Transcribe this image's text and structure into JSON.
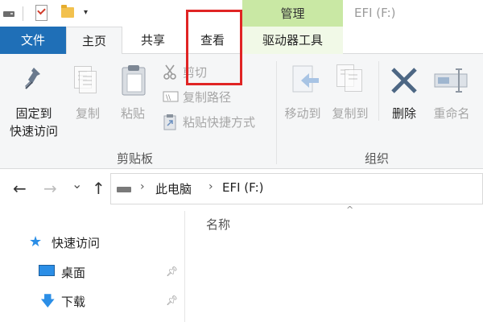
{
  "title_bar": {
    "context_tab": "管理",
    "window_title": "EFI (F:)",
    "dropdown_glyph": "▾"
  },
  "tabs": {
    "file": "文件",
    "home": "主页",
    "share": "共享",
    "view": "查看",
    "drive_tools": "驱动器工具"
  },
  "ribbon": {
    "clipboard": {
      "pin_label_line1": "固定到",
      "pin_label_line2": "快速访问",
      "copy": "复制",
      "paste": "粘贴",
      "cut": "剪切",
      "copy_path": "复制路径",
      "paste_shortcut": "粘贴快捷方式",
      "group_label": "剪贴板"
    },
    "organize": {
      "move_to": "移动到",
      "copy_to": "复制到",
      "delete": "删除",
      "rename": "重命名",
      "group_label": "组织"
    }
  },
  "address": {
    "back": "←",
    "forward": "→",
    "recent": "⌄",
    "up": "↑",
    "separator": "›",
    "crumbs": [
      "此电脑",
      "EFI (F:)"
    ]
  },
  "file_list": {
    "column_name": "名称",
    "sort_caret": "^"
  },
  "nav_pane": {
    "quick_access": "快速访问",
    "items": [
      {
        "label": "桌面",
        "icon": "desktop-icon",
        "pinned": true
      },
      {
        "label": "下载",
        "icon": "download-icon",
        "pinned": true
      }
    ]
  },
  "colors": {
    "file_tab": "#1f6fb7",
    "manage_tab": "#c9e8a4",
    "highlight_box": "#e02424",
    "star": "#2b8ee6"
  }
}
